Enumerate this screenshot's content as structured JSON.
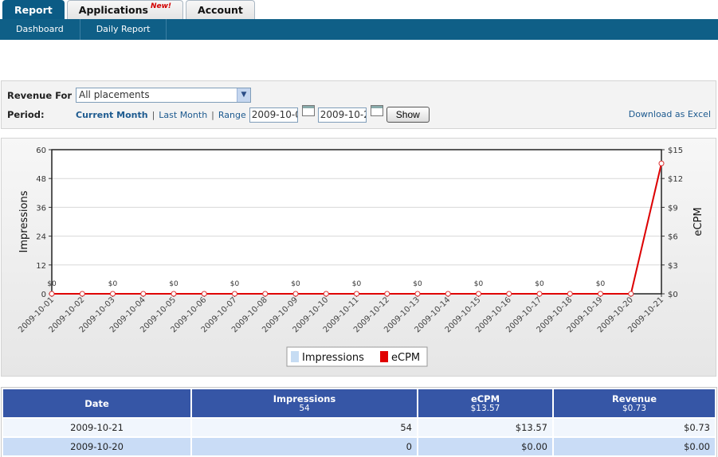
{
  "tabs": [
    {
      "label": "Report",
      "badge": ""
    },
    {
      "label": "Applications",
      "badge": "New!"
    },
    {
      "label": "Account",
      "badge": ""
    }
  ],
  "subnav": [
    "Dashboard",
    "Daily Report"
  ],
  "filters": {
    "revenue_label": "Revenue For",
    "revenue_value": "All placements",
    "period_label": "Period:",
    "current_month": "Current Month",
    "last_month": "Last Month",
    "range": "Range",
    "sep": "|",
    "start_date": "2009-10-0",
    "end_date": "2009-10-2",
    "show": "Show",
    "download": "Download as Excel"
  },
  "chart_data": {
    "type": "line",
    "categories": [
      "2009-10-01",
      "2009-10-02",
      "2009-10-03",
      "2009-10-04",
      "2009-10-05",
      "2009-10-06",
      "2009-10-07",
      "2009-10-08",
      "2009-10-09",
      "2009-10-10",
      "2009-10-11",
      "2009-10-12",
      "2009-10-13",
      "2009-10-14",
      "2009-10-15",
      "2009-10-16",
      "2009-10-17",
      "2009-10-18",
      "2009-10-19",
      "2009-10-20",
      "2009-10-21"
    ],
    "series": [
      {
        "name": "Impressions",
        "axis": "left",
        "values": [
          0,
          0,
          0,
          0,
          0,
          0,
          0,
          0,
          0,
          0,
          0,
          0,
          0,
          0,
          0,
          0,
          0,
          0,
          0,
          0,
          54
        ],
        "color": "#c6dcf3"
      },
      {
        "name": "eCPM",
        "axis": "right",
        "values": [
          0,
          0,
          0,
          0,
          0,
          0,
          0,
          0,
          0,
          0,
          0,
          0,
          0,
          0,
          0,
          0,
          0,
          0,
          0,
          0,
          13.57
        ],
        "color": "#e00000"
      }
    ],
    "point_labels": [
      "$0",
      "",
      "$0",
      "",
      "$0",
      "",
      "$0",
      "",
      "$0",
      "",
      "$0",
      "",
      "$0",
      "",
      "$0",
      "",
      "$0",
      "",
      "$0",
      "",
      ""
    ],
    "ylabel_left": "Impressions",
    "ylabel_right": "eCPM",
    "ylim_left": [
      0,
      60
    ],
    "ylim_right": [
      0,
      15
    ],
    "yticks_left": [
      "0",
      "12",
      "24",
      "36",
      "48",
      "60"
    ],
    "yticks_right": [
      "$0",
      "$3",
      "$6",
      "$9",
      "$12",
      "$15"
    ],
    "grid": true,
    "legend": "bottom-center"
  },
  "table": {
    "headers": [
      {
        "label": "Date",
        "sub": ""
      },
      {
        "label": "Impressions",
        "sub": "54"
      },
      {
        "label": "eCPM",
        "sub": "$13.57"
      },
      {
        "label": "Revenue",
        "sub": "$0.73"
      }
    ],
    "rows": [
      [
        "2009-10-21",
        "54",
        "$13.57",
        "$0.73"
      ],
      [
        "2009-10-20",
        "0",
        "$0.00",
        "$0.00"
      ]
    ]
  }
}
